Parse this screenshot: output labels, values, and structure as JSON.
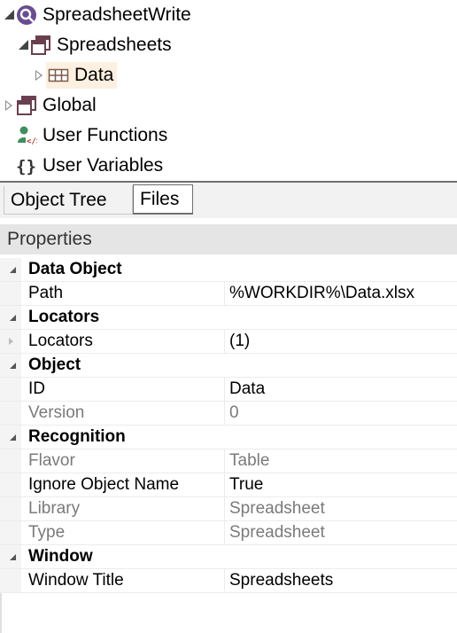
{
  "tree": {
    "root": {
      "label": "SpreadsheetWrite"
    },
    "spreadsheets": {
      "label": "Spreadsheets"
    },
    "data": {
      "label": "Data"
    },
    "global": {
      "label": "Global"
    },
    "user_functions": {
      "label": "User Functions"
    },
    "user_variables": {
      "label": "User Variables"
    }
  },
  "tabs": [
    {
      "label": "Object Tree",
      "active": false
    },
    {
      "label": "Files",
      "active": true
    }
  ],
  "properties": {
    "header": "Properties",
    "rows": [
      {
        "kind": "category",
        "name": "Data Object"
      },
      {
        "kind": "property",
        "name": "Path",
        "value": "%WORKDIR%\\Data.xlsx",
        "readonly": false
      },
      {
        "kind": "category",
        "name": "Locators"
      },
      {
        "kind": "property",
        "name": "Locators",
        "value": "(1)",
        "readonly": false,
        "expandable": true
      },
      {
        "kind": "category",
        "name": "Object"
      },
      {
        "kind": "property",
        "name": "ID",
        "value": "Data",
        "readonly": false
      },
      {
        "kind": "property",
        "name": "Version",
        "value": "0",
        "readonly": true
      },
      {
        "kind": "category",
        "name": "Recognition"
      },
      {
        "kind": "property",
        "name": "Flavor",
        "value": "Table",
        "readonly": true
      },
      {
        "kind": "property",
        "name": "Ignore Object Name",
        "value": "True",
        "readonly": false
      },
      {
        "kind": "property",
        "name": "Library",
        "value": "Spreadsheet",
        "readonly": true
      },
      {
        "kind": "property",
        "name": "Type",
        "value": "Spreadsheet",
        "readonly": true
      },
      {
        "kind": "category",
        "name": "Window"
      },
      {
        "kind": "property",
        "name": "Window Title",
        "value": "Spreadsheets",
        "readonly": false
      }
    ]
  },
  "colors": {
    "accent_purple": "#6a4c93",
    "selection_bg": "#fdf0e0",
    "readonly_text": "#7a7a7a"
  }
}
